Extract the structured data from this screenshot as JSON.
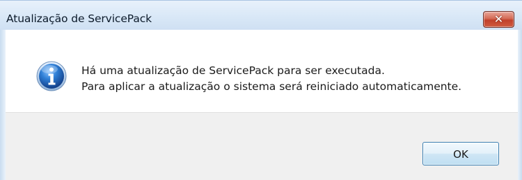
{
  "window": {
    "title": "Atualização de ServicePack",
    "close_icon": "close-icon"
  },
  "message": {
    "icon": "info-icon",
    "line1": "Há uma atualização de ServicePack para ser executada.",
    "line2": "Para aplicar a atualização o sistema será reiniciado automaticamente."
  },
  "buttons": {
    "ok_label": "OK"
  },
  "colors": {
    "titlebar": "#d9e8f7",
    "close_button": "#c1412b",
    "content_background": "#ffffff",
    "footer_background": "#f0f0f0",
    "info_icon_blue": "#1e5fb3",
    "ok_border": "#3c7fb1"
  }
}
